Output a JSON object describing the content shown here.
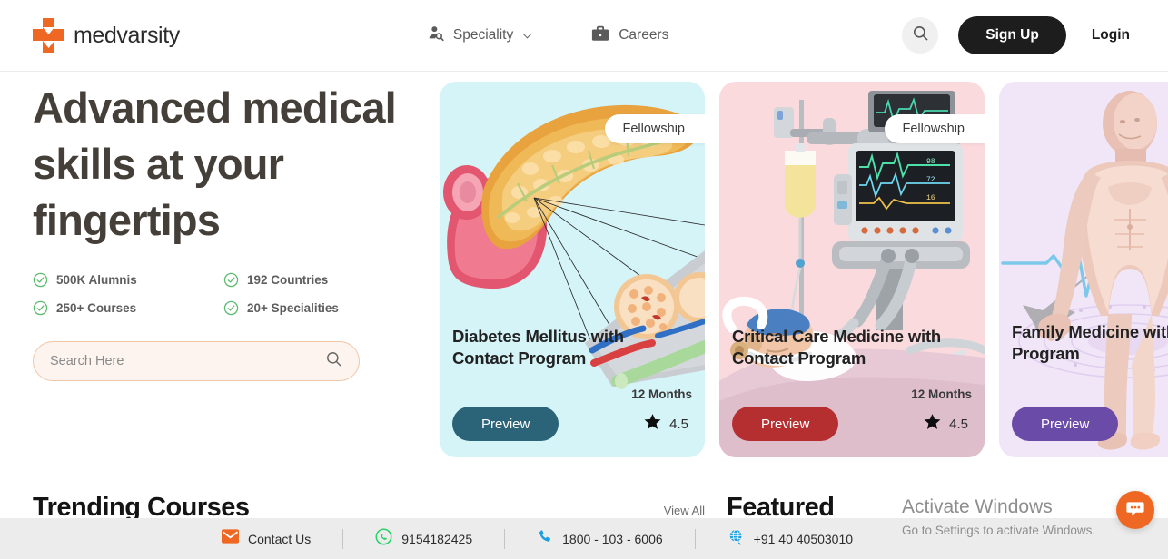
{
  "brand": {
    "name": "medvarsity"
  },
  "nav": {
    "items": [
      {
        "label": "Speciality",
        "icon": "person-search-icon",
        "has_caret": true
      },
      {
        "label": "Careers",
        "icon": "briefcase-icon",
        "has_caret": false
      }
    ]
  },
  "header_actions": {
    "search_icon": "search-icon",
    "signup_label": "Sign Up",
    "login_label": "Login"
  },
  "hero": {
    "title": "Advanced\nmedical skills\nat your\nfingertips",
    "stats": [
      {
        "label": "500K Alumnis"
      },
      {
        "label": "192 Countries"
      },
      {
        "label": "250+ Courses"
      },
      {
        "label": "20+ Specialities"
      }
    ],
    "search": {
      "placeholder": "Search Here",
      "value": "",
      "icon": "search-icon"
    }
  },
  "cards": [
    {
      "badge": "Fellowship",
      "title": "Diabetes Mellitus with\nContact Program",
      "duration": "12 Months",
      "preview_label": "Preview",
      "rating": "4.5",
      "bg": "#d4f4f8",
      "button_color": "#2b6378",
      "art": "pancreas-illustration"
    },
    {
      "badge": "Fellowship",
      "title": "Critical Care Medicine with\nContact Program",
      "duration": "12 Months",
      "preview_label": "Preview",
      "rating": "4.5",
      "bg": "#fbdade",
      "button_color": "#b52f31",
      "art": "icu-ventilator-illustration"
    },
    {
      "badge": "",
      "title": "Family Medicine with Contact\nProgram",
      "duration": "",
      "preview_label": "Preview",
      "rating": "",
      "bg": "#f0e6f8",
      "button_color": "#6b4ba8",
      "art": "human-anatomy-illustration"
    }
  ],
  "sections": {
    "trending_title": "Trending Courses",
    "view_all_label": "View All",
    "featured_title": "Featured"
  },
  "windows_watermark": {
    "line1": "Activate Windows",
    "line2": "Go to Settings to activate Windows."
  },
  "contact_bar": {
    "items": [
      {
        "label": "Contact Us",
        "icon": "envelope-icon",
        "color": "#ef6823"
      },
      {
        "label": "9154182425",
        "icon": "whatsapp-icon",
        "color": "#25d366"
      },
      {
        "label": "1800 - 103 - 6006",
        "icon": "phone-icon",
        "color": "#1b9fe0"
      },
      {
        "label": "+91 40 40503010",
        "icon": "globe-icon",
        "color": "#1b9fe0"
      }
    ]
  },
  "chat_widget": {
    "icon": "chat-bubble-icon",
    "color": "#ef6823"
  }
}
